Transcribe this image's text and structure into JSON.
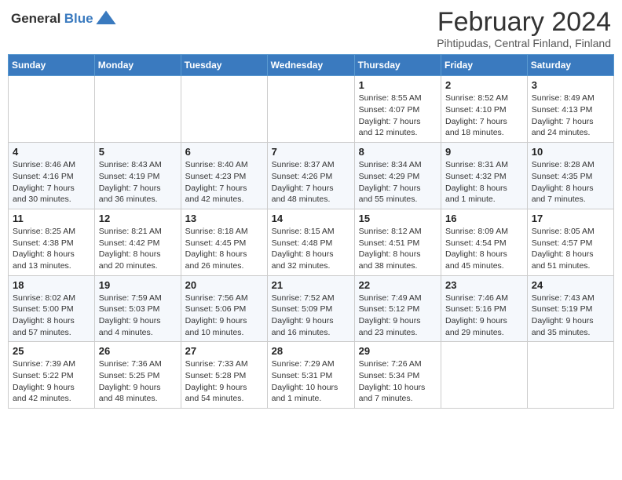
{
  "logo": {
    "line1": "General",
    "line2": "Blue"
  },
  "title": "February 2024",
  "subtitle": "Pihtipudas, Central Finland, Finland",
  "weekdays": [
    "Sunday",
    "Monday",
    "Tuesday",
    "Wednesday",
    "Thursday",
    "Friday",
    "Saturday"
  ],
  "weeks": [
    [
      {
        "day": "",
        "info": ""
      },
      {
        "day": "",
        "info": ""
      },
      {
        "day": "",
        "info": ""
      },
      {
        "day": "",
        "info": ""
      },
      {
        "day": "1",
        "info": "Sunrise: 8:55 AM\nSunset: 4:07 PM\nDaylight: 7 hours\nand 12 minutes."
      },
      {
        "day": "2",
        "info": "Sunrise: 8:52 AM\nSunset: 4:10 PM\nDaylight: 7 hours\nand 18 minutes."
      },
      {
        "day": "3",
        "info": "Sunrise: 8:49 AM\nSunset: 4:13 PM\nDaylight: 7 hours\nand 24 minutes."
      }
    ],
    [
      {
        "day": "4",
        "info": "Sunrise: 8:46 AM\nSunset: 4:16 PM\nDaylight: 7 hours\nand 30 minutes."
      },
      {
        "day": "5",
        "info": "Sunrise: 8:43 AM\nSunset: 4:19 PM\nDaylight: 7 hours\nand 36 minutes."
      },
      {
        "day": "6",
        "info": "Sunrise: 8:40 AM\nSunset: 4:23 PM\nDaylight: 7 hours\nand 42 minutes."
      },
      {
        "day": "7",
        "info": "Sunrise: 8:37 AM\nSunset: 4:26 PM\nDaylight: 7 hours\nand 48 minutes."
      },
      {
        "day": "8",
        "info": "Sunrise: 8:34 AM\nSunset: 4:29 PM\nDaylight: 7 hours\nand 55 minutes."
      },
      {
        "day": "9",
        "info": "Sunrise: 8:31 AM\nSunset: 4:32 PM\nDaylight: 8 hours\nand 1 minute."
      },
      {
        "day": "10",
        "info": "Sunrise: 8:28 AM\nSunset: 4:35 PM\nDaylight: 8 hours\nand 7 minutes."
      }
    ],
    [
      {
        "day": "11",
        "info": "Sunrise: 8:25 AM\nSunset: 4:38 PM\nDaylight: 8 hours\nand 13 minutes."
      },
      {
        "day": "12",
        "info": "Sunrise: 8:21 AM\nSunset: 4:42 PM\nDaylight: 8 hours\nand 20 minutes."
      },
      {
        "day": "13",
        "info": "Sunrise: 8:18 AM\nSunset: 4:45 PM\nDaylight: 8 hours\nand 26 minutes."
      },
      {
        "day": "14",
        "info": "Sunrise: 8:15 AM\nSunset: 4:48 PM\nDaylight: 8 hours\nand 32 minutes."
      },
      {
        "day": "15",
        "info": "Sunrise: 8:12 AM\nSunset: 4:51 PM\nDaylight: 8 hours\nand 38 minutes."
      },
      {
        "day": "16",
        "info": "Sunrise: 8:09 AM\nSunset: 4:54 PM\nDaylight: 8 hours\nand 45 minutes."
      },
      {
        "day": "17",
        "info": "Sunrise: 8:05 AM\nSunset: 4:57 PM\nDaylight: 8 hours\nand 51 minutes."
      }
    ],
    [
      {
        "day": "18",
        "info": "Sunrise: 8:02 AM\nSunset: 5:00 PM\nDaylight: 8 hours\nand 57 minutes."
      },
      {
        "day": "19",
        "info": "Sunrise: 7:59 AM\nSunset: 5:03 PM\nDaylight: 9 hours\nand 4 minutes."
      },
      {
        "day": "20",
        "info": "Sunrise: 7:56 AM\nSunset: 5:06 PM\nDaylight: 9 hours\nand 10 minutes."
      },
      {
        "day": "21",
        "info": "Sunrise: 7:52 AM\nSunset: 5:09 PM\nDaylight: 9 hours\nand 16 minutes."
      },
      {
        "day": "22",
        "info": "Sunrise: 7:49 AM\nSunset: 5:12 PM\nDaylight: 9 hours\nand 23 minutes."
      },
      {
        "day": "23",
        "info": "Sunrise: 7:46 AM\nSunset: 5:16 PM\nDaylight: 9 hours\nand 29 minutes."
      },
      {
        "day": "24",
        "info": "Sunrise: 7:43 AM\nSunset: 5:19 PM\nDaylight: 9 hours\nand 35 minutes."
      }
    ],
    [
      {
        "day": "25",
        "info": "Sunrise: 7:39 AM\nSunset: 5:22 PM\nDaylight: 9 hours\nand 42 minutes."
      },
      {
        "day": "26",
        "info": "Sunrise: 7:36 AM\nSunset: 5:25 PM\nDaylight: 9 hours\nand 48 minutes."
      },
      {
        "day": "27",
        "info": "Sunrise: 7:33 AM\nSunset: 5:28 PM\nDaylight: 9 hours\nand 54 minutes."
      },
      {
        "day": "28",
        "info": "Sunrise: 7:29 AM\nSunset: 5:31 PM\nDaylight: 10 hours\nand 1 minute."
      },
      {
        "day": "29",
        "info": "Sunrise: 7:26 AM\nSunset: 5:34 PM\nDaylight: 10 hours\nand 7 minutes."
      },
      {
        "day": "",
        "info": ""
      },
      {
        "day": "",
        "info": ""
      }
    ]
  ]
}
